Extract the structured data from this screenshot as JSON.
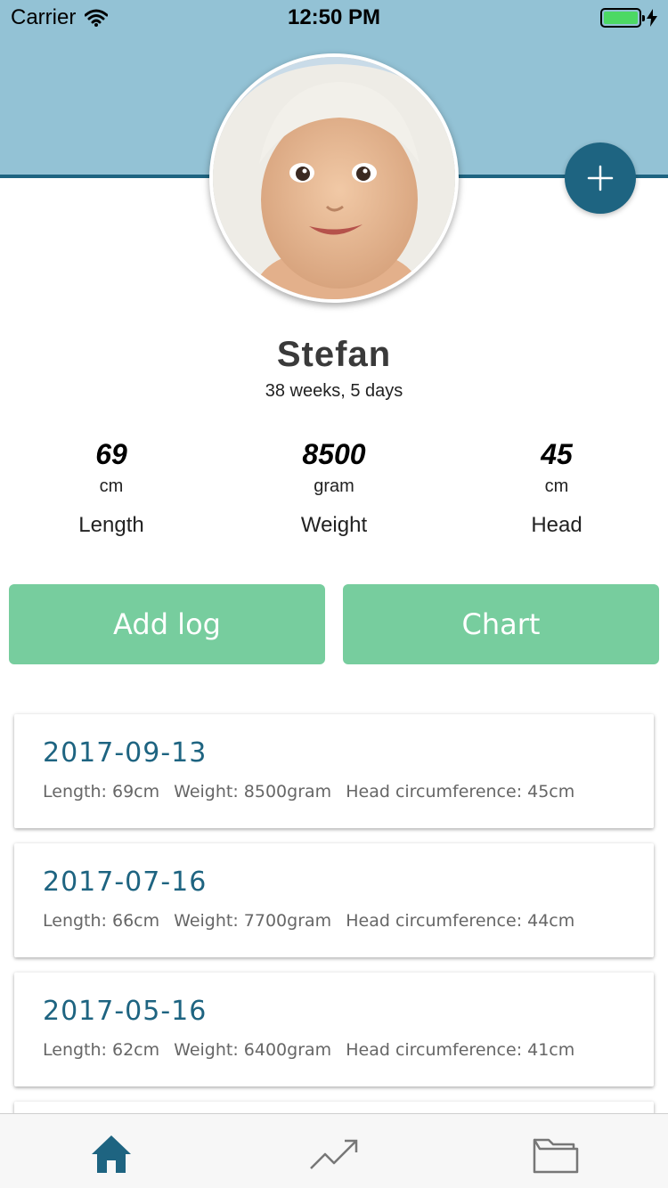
{
  "status_bar": {
    "carrier": "Carrier",
    "time": "12:50 PM"
  },
  "profile": {
    "name": "Stefan",
    "age": "38 weeks, 5 days"
  },
  "stats": [
    {
      "value": "69",
      "unit": "cm",
      "label": "Length"
    },
    {
      "value": "8500",
      "unit": "gram",
      "label": "Weight"
    },
    {
      "value": "45",
      "unit": "cm",
      "label": "Head"
    }
  ],
  "actions": {
    "add_log": "Add log",
    "chart": "Chart"
  },
  "logs": [
    {
      "date": "2017-09-13",
      "length": "Length: 69cm",
      "weight": "Weight: 8500gram",
      "head": "Head circumference: 45cm"
    },
    {
      "date": "2017-07-16",
      "length": "Length: 66cm",
      "weight": "Weight: 7700gram",
      "head": "Head circumference: 44cm"
    },
    {
      "date": "2017-05-16",
      "length": "Length: 62cm",
      "weight": "Weight: 6400gram",
      "head": "Head circumference: 41cm"
    }
  ],
  "tabs": [
    {
      "icon": "home-icon",
      "active": true
    },
    {
      "icon": "trending-chart-icon",
      "active": false
    },
    {
      "icon": "folder-icon",
      "active": false
    }
  ],
  "colors": {
    "header": "#93c2d5",
    "accent": "#1e6481",
    "button": "#77cd9e",
    "battery": "#4cd964"
  }
}
